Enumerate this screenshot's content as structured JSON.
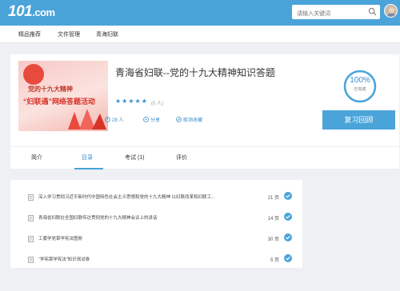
{
  "header": {
    "logo_text": "101",
    "logo_suffix": ".com",
    "search_placeholder": "请输入关键词"
  },
  "nav": {
    "items": [
      {
        "label": "精品推荐"
      },
      {
        "label": "文件管理"
      },
      {
        "label": "青海妇联"
      }
    ]
  },
  "course": {
    "title": "青海省妇联--党的十九大精神知识答题",
    "cover_line1": "党的十九大精神",
    "cover_line2": "“妇联通”网络答题活动",
    "rating_stars": 5,
    "rating_count": "(0 人)",
    "learners": "28 人",
    "share": "分享",
    "favorite": "取消收藏",
    "progress_percent": "100%",
    "progress_value": 1.0,
    "progress_label": "已完成",
    "review_button": "复习回顾"
  },
  "tabs": [
    {
      "label": "简介"
    },
    {
      "label": "目录"
    },
    {
      "label": "考试 (1)"
    },
    {
      "label": "评价"
    }
  ],
  "chapters": [
    {
      "title": "深入学习贯彻习近平新时代中国特色社会主义思想和党的十九大精神 以妇联改革和妇联工...",
      "pages": "21 页"
    },
    {
      "title": "青海省妇联在全国妇联传达贯彻党的十九大精神会议上的讲话",
      "pages": "14 页"
    },
    {
      "title": "工委学党章学宪法图册",
      "pages": "30 页"
    },
    {
      "title": "“学宪章学宪法”知识测试卷",
      "pages": "5 页"
    }
  ],
  "colors": {
    "accent": "#4aa4d9",
    "link": "#3a8ecb",
    "background": "#eef0f3"
  }
}
